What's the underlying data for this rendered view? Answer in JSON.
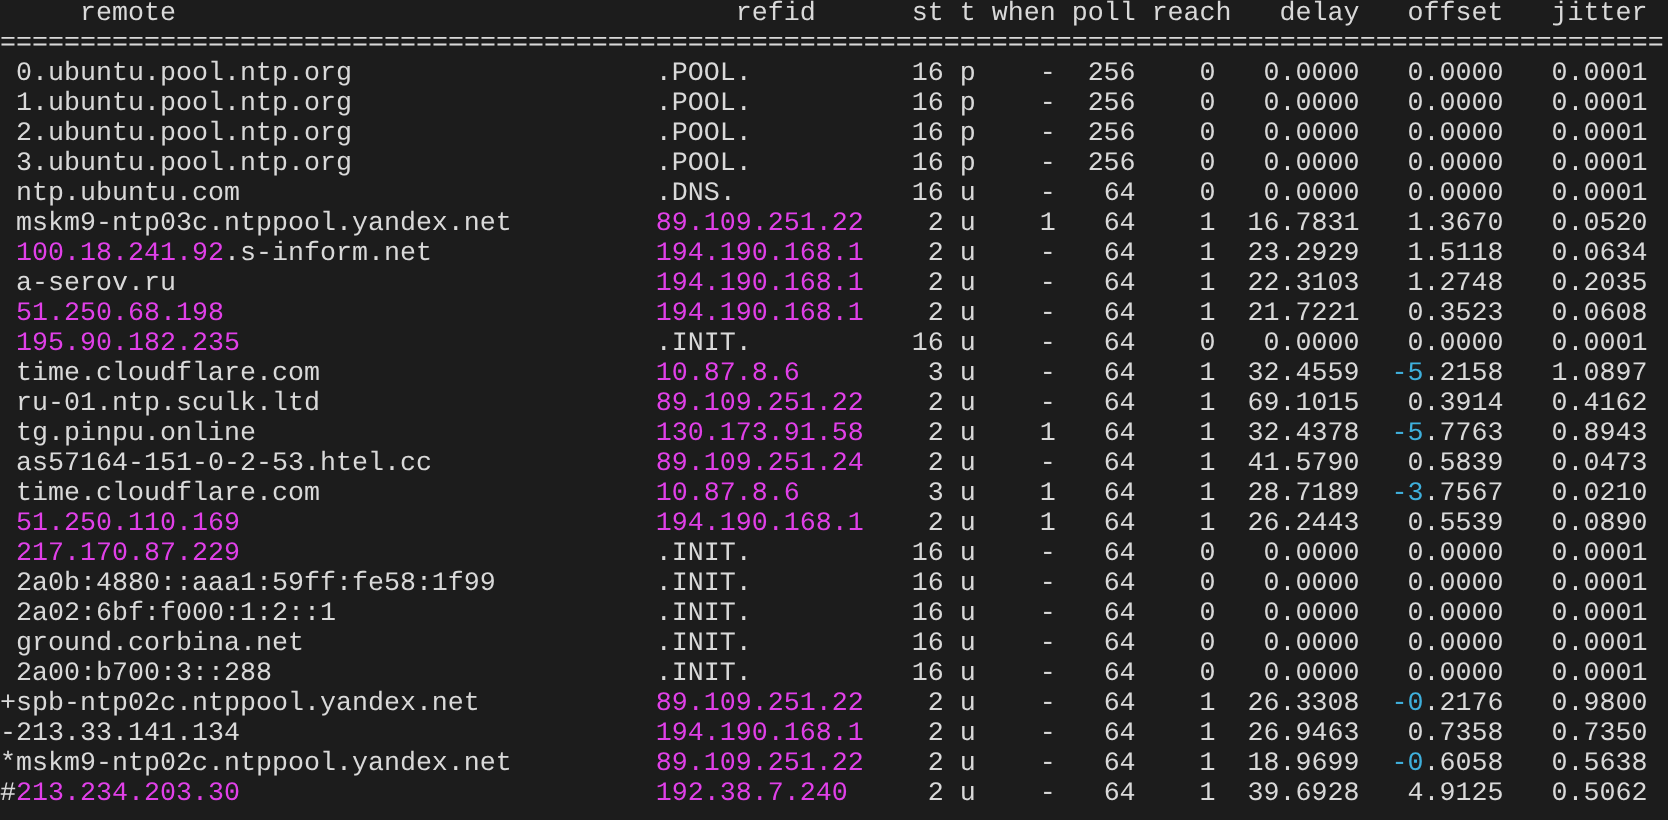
{
  "columns": [
    "remote",
    "refid",
    "st",
    "t",
    "when",
    "poll",
    "reach",
    "delay",
    "offset",
    "jitter"
  ],
  "separator": "========================================================================================================",
  "rows": [
    {
      "remote": [
        {
          "kind": "plain",
          "text": "0.ubuntu.pool.ntp.org"
        }
      ],
      "refid": [
        {
          "kind": "plain",
          "text": ".POOL."
        }
      ],
      "st": "16",
      "t": "p",
      "when": "-",
      "poll": "256",
      "reach": "0",
      "delay": "0.0000",
      "offset": [
        {
          "kind": "plain",
          "text": "0.0000"
        }
      ],
      "jitter": "0.0001"
    },
    {
      "remote": [
        {
          "kind": "plain",
          "text": "1.ubuntu.pool.ntp.org"
        }
      ],
      "refid": [
        {
          "kind": "plain",
          "text": ".POOL."
        }
      ],
      "st": "16",
      "t": "p",
      "when": "-",
      "poll": "256",
      "reach": "0",
      "delay": "0.0000",
      "offset": [
        {
          "kind": "plain",
          "text": "0.0000"
        }
      ],
      "jitter": "0.0001"
    },
    {
      "remote": [
        {
          "kind": "plain",
          "text": "2.ubuntu.pool.ntp.org"
        }
      ],
      "refid": [
        {
          "kind": "plain",
          "text": ".POOL."
        }
      ],
      "st": "16",
      "t": "p",
      "when": "-",
      "poll": "256",
      "reach": "0",
      "delay": "0.0000",
      "offset": [
        {
          "kind": "plain",
          "text": "0.0000"
        }
      ],
      "jitter": "0.0001"
    },
    {
      "remote": [
        {
          "kind": "plain",
          "text": "3.ubuntu.pool.ntp.org"
        }
      ],
      "refid": [
        {
          "kind": "plain",
          "text": ".POOL."
        }
      ],
      "st": "16",
      "t": "p",
      "when": "-",
      "poll": "256",
      "reach": "0",
      "delay": "0.0000",
      "offset": [
        {
          "kind": "plain",
          "text": "0.0000"
        }
      ],
      "jitter": "0.0001"
    },
    {
      "remote": [
        {
          "kind": "plain",
          "text": "ntp.ubuntu.com"
        }
      ],
      "refid": [
        {
          "kind": "plain",
          "text": ".DNS."
        }
      ],
      "st": "16",
      "t": "u",
      "when": "-",
      "poll": "64",
      "reach": "0",
      "delay": "0.0000",
      "offset": [
        {
          "kind": "plain",
          "text": "0.0000"
        }
      ],
      "jitter": "0.0001"
    },
    {
      "remote": [
        {
          "kind": "plain",
          "text": "mskm9-ntp03c.ntppool.yandex.net"
        }
      ],
      "refid": [
        {
          "kind": "accent",
          "text": "89.109.251.22"
        }
      ],
      "st": "2",
      "t": "u",
      "when": "1",
      "poll": "64",
      "reach": "1",
      "delay": "16.7831",
      "offset": [
        {
          "kind": "plain",
          "text": "1.3670"
        }
      ],
      "jitter": "0.0520"
    },
    {
      "remote": [
        {
          "kind": "accent",
          "text": "100.18.241.92"
        },
        {
          "kind": "plain",
          "text": ".s-inform.net"
        }
      ],
      "refid": [
        {
          "kind": "accent",
          "text": "194.190.168.1"
        }
      ],
      "st": "2",
      "t": "u",
      "when": "-",
      "poll": "64",
      "reach": "1",
      "delay": "23.2929",
      "offset": [
        {
          "kind": "plain",
          "text": "1.5118"
        }
      ],
      "jitter": "0.0634"
    },
    {
      "remote": [
        {
          "kind": "plain",
          "text": "a-serov.ru"
        }
      ],
      "refid": [
        {
          "kind": "accent",
          "text": "194.190.168.1"
        }
      ],
      "st": "2",
      "t": "u",
      "when": "-",
      "poll": "64",
      "reach": "1",
      "delay": "22.3103",
      "offset": [
        {
          "kind": "plain",
          "text": "1.2748"
        }
      ],
      "jitter": "0.2035"
    },
    {
      "remote": [
        {
          "kind": "accent",
          "text": "51.250.68.198"
        }
      ],
      "refid": [
        {
          "kind": "accent",
          "text": "194.190.168.1"
        }
      ],
      "st": "2",
      "t": "u",
      "when": "-",
      "poll": "64",
      "reach": "1",
      "delay": "21.7221",
      "offset": [
        {
          "kind": "plain",
          "text": "0.3523"
        }
      ],
      "jitter": "0.0608"
    },
    {
      "remote": [
        {
          "kind": "accent",
          "text": "195.90.182.235"
        }
      ],
      "refid": [
        {
          "kind": "plain",
          "text": ".INIT."
        }
      ],
      "st": "16",
      "t": "u",
      "when": "-",
      "poll": "64",
      "reach": "0",
      "delay": "0.0000",
      "offset": [
        {
          "kind": "plain",
          "text": "0.0000"
        }
      ],
      "jitter": "0.0001"
    },
    {
      "remote": [
        {
          "kind": "plain",
          "text": "time.cloudflare.com"
        }
      ],
      "refid": [
        {
          "kind": "accent",
          "text": "10.87.8.6"
        }
      ],
      "st": "3",
      "t": "u",
      "when": "-",
      "poll": "64",
      "reach": "1",
      "delay": "32.4559",
      "offset": [
        {
          "kind": "negative",
          "text": "-5"
        },
        {
          "kind": "plain",
          "text": ".2158"
        }
      ],
      "jitter": "1.0897"
    },
    {
      "remote": [
        {
          "kind": "plain",
          "text": "ru-01.ntp.sculk.ltd"
        }
      ],
      "refid": [
        {
          "kind": "accent",
          "text": "89.109.251.22"
        }
      ],
      "st": "2",
      "t": "u",
      "when": "-",
      "poll": "64",
      "reach": "1",
      "delay": "69.1015",
      "offset": [
        {
          "kind": "plain",
          "text": "0.3914"
        }
      ],
      "jitter": "0.4162"
    },
    {
      "remote": [
        {
          "kind": "plain",
          "text": "tg.pinpu.online"
        }
      ],
      "refid": [
        {
          "kind": "accent",
          "text": "130.173.91.58"
        }
      ],
      "st": "2",
      "t": "u",
      "when": "1",
      "poll": "64",
      "reach": "1",
      "delay": "32.4378",
      "offset": [
        {
          "kind": "negative",
          "text": "-5"
        },
        {
          "kind": "plain",
          "text": ".7763"
        }
      ],
      "jitter": "0.8943"
    },
    {
      "remote": [
        {
          "kind": "plain",
          "text": "as57164-151-0-2-53.htel.cc"
        }
      ],
      "refid": [
        {
          "kind": "accent",
          "text": "89.109.251.24"
        }
      ],
      "st": "2",
      "t": "u",
      "when": "-",
      "poll": "64",
      "reach": "1",
      "delay": "41.5790",
      "offset": [
        {
          "kind": "plain",
          "text": "0.5839"
        }
      ],
      "jitter": "0.0473"
    },
    {
      "remote": [
        {
          "kind": "plain",
          "text": "time.cloudflare.com"
        }
      ],
      "refid": [
        {
          "kind": "accent",
          "text": "10.87.8.6"
        }
      ],
      "st": "3",
      "t": "u",
      "when": "1",
      "poll": "64",
      "reach": "1",
      "delay": "28.7189",
      "offset": [
        {
          "kind": "negative",
          "text": "-3"
        },
        {
          "kind": "plain",
          "text": ".7567"
        }
      ],
      "jitter": "0.0210"
    },
    {
      "remote": [
        {
          "kind": "accent",
          "text": "51.250.110.169"
        }
      ],
      "refid": [
        {
          "kind": "accent",
          "text": "194.190.168.1"
        }
      ],
      "st": "2",
      "t": "u",
      "when": "1",
      "poll": "64",
      "reach": "1",
      "delay": "26.2443",
      "offset": [
        {
          "kind": "plain",
          "text": "0.5539"
        }
      ],
      "jitter": "0.0890"
    },
    {
      "remote": [
        {
          "kind": "accent",
          "text": "217.170.87.229"
        }
      ],
      "refid": [
        {
          "kind": "plain",
          "text": ".INIT."
        }
      ],
      "st": "16",
      "t": "u",
      "when": "-",
      "poll": "64",
      "reach": "0",
      "delay": "0.0000",
      "offset": [
        {
          "kind": "plain",
          "text": "0.0000"
        }
      ],
      "jitter": "0.0001"
    },
    {
      "remote": [
        {
          "kind": "plain",
          "text": "2a0b:4880::aaa1:59ff:fe58:1f99"
        }
      ],
      "refid": [
        {
          "kind": "plain",
          "text": ".INIT."
        }
      ],
      "st": "16",
      "t": "u",
      "when": "-",
      "poll": "64",
      "reach": "0",
      "delay": "0.0000",
      "offset": [
        {
          "kind": "plain",
          "text": "0.0000"
        }
      ],
      "jitter": "0.0001"
    },
    {
      "remote": [
        {
          "kind": "plain",
          "text": "2a02:6bf:f000:1:2::1"
        }
      ],
      "refid": [
        {
          "kind": "plain",
          "text": ".INIT."
        }
      ],
      "st": "16",
      "t": "u",
      "when": "-",
      "poll": "64",
      "reach": "0",
      "delay": "0.0000",
      "offset": [
        {
          "kind": "plain",
          "text": "0.0000"
        }
      ],
      "jitter": "0.0001"
    },
    {
      "remote": [
        {
          "kind": "plain",
          "text": "ground.corbina.net"
        }
      ],
      "refid": [
        {
          "kind": "plain",
          "text": ".INIT."
        }
      ],
      "st": "16",
      "t": "u",
      "when": "-",
      "poll": "64",
      "reach": "0",
      "delay": "0.0000",
      "offset": [
        {
          "kind": "plain",
          "text": "0.0000"
        }
      ],
      "jitter": "0.0001"
    },
    {
      "remote": [
        {
          "kind": "plain",
          "text": "2a00:b700:3::288"
        }
      ],
      "refid": [
        {
          "kind": "plain",
          "text": ".INIT."
        }
      ],
      "st": "16",
      "t": "u",
      "when": "-",
      "poll": "64",
      "reach": "0",
      "delay": "0.0000",
      "offset": [
        {
          "kind": "plain",
          "text": "0.0000"
        }
      ],
      "jitter": "0.0001"
    },
    {
      "tally": "+",
      "remote": [
        {
          "kind": "plain",
          "text": "spb-ntp02c.ntppool.yandex.net"
        }
      ],
      "refid": [
        {
          "kind": "accent",
          "text": "89.109.251.22"
        }
      ],
      "st": "2",
      "t": "u",
      "when": "-",
      "poll": "64",
      "reach": "1",
      "delay": "26.3308",
      "offset": [
        {
          "kind": "negative",
          "text": "-0"
        },
        {
          "kind": "plain",
          "text": ".2176"
        }
      ],
      "jitter": "0.9800"
    },
    {
      "tally": "-",
      "remote": [
        {
          "kind": "plain",
          "text": "213.33.141.134"
        }
      ],
      "refid": [
        {
          "kind": "accent",
          "text": "194.190.168.1"
        }
      ],
      "st": "2",
      "t": "u",
      "when": "-",
      "poll": "64",
      "reach": "1",
      "delay": "26.9463",
      "offset": [
        {
          "kind": "plain",
          "text": "0.7358"
        }
      ],
      "jitter": "0.7350"
    },
    {
      "tally": "*",
      "remote": [
        {
          "kind": "plain",
          "text": "mskm9-ntp02c.ntppool.yandex.net"
        }
      ],
      "refid": [
        {
          "kind": "accent",
          "text": "89.109.251.22"
        }
      ],
      "st": "2",
      "t": "u",
      "when": "-",
      "poll": "64",
      "reach": "1",
      "delay": "18.9699",
      "offset": [
        {
          "kind": "negative",
          "text": "-0"
        },
        {
          "kind": "plain",
          "text": ".6058"
        }
      ],
      "jitter": "0.5638"
    },
    {
      "tally": "#",
      "remote": [
        {
          "kind": "accent",
          "text": "213.234.203.30"
        }
      ],
      "refid": [
        {
          "kind": "accent",
          "text": "192.38.7.240"
        }
      ],
      "st": "2",
      "t": "u",
      "when": "-",
      "poll": "64",
      "reach": "1",
      "delay": "39.6928",
      "offset": [
        {
          "kind": "plain",
          "text": "4.9125"
        }
      ],
      "jitter": "0.5062"
    }
  ]
}
